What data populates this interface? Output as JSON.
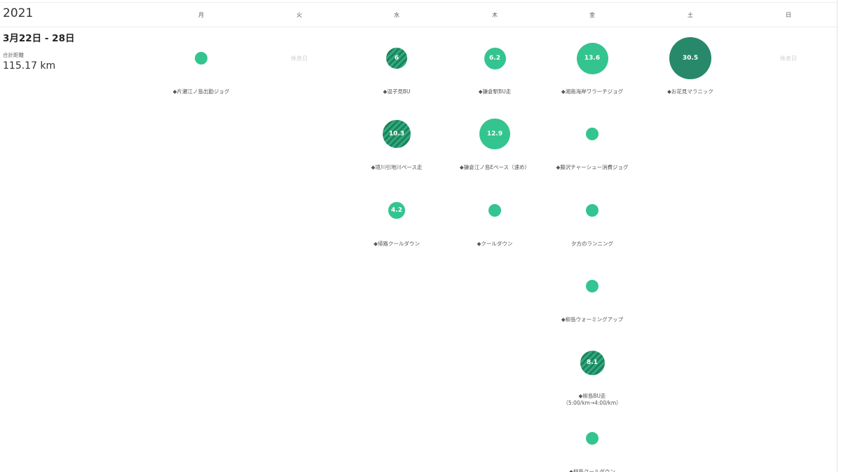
{
  "year": "2021",
  "days": [
    "月",
    "火",
    "水",
    "木",
    "金",
    "土",
    "日"
  ],
  "week": {
    "range": "3月22日 - 28日",
    "total_label": "合計距離",
    "total_value": "115.17 km"
  },
  "rest_label": "休息日",
  "colors": {
    "plain": "#34c490",
    "dark": "#27896a",
    "stripe_a": "#2faa7d",
    "stripe_b": "#1e7f5c"
  },
  "activities": [
    {
      "day": 0,
      "row": 0,
      "value": "",
      "label": "◆片瀬江ノ島出勤ジョグ",
      "style": "plain",
      "size": 18
    },
    {
      "day": 2,
      "row": 0,
      "value": "6",
      "label": "◆逗子見BU",
      "style": "striped",
      "size": 30
    },
    {
      "day": 2,
      "row": 1,
      "value": "10.3",
      "label": "◆境川引地川ペース走",
      "style": "striped",
      "size": 40
    },
    {
      "day": 2,
      "row": 2,
      "value": "4.2",
      "label": "◆帰路クールダウン",
      "style": "plain",
      "size": 24
    },
    {
      "day": 3,
      "row": 0,
      "value": "6.2",
      "label": "◆鎌倉駅BU走",
      "style": "plain",
      "size": 31
    },
    {
      "day": 3,
      "row": 1,
      "value": "12.9",
      "label": "◆鎌倉江ノ島Eペース（速め）",
      "style": "plain",
      "size": 44
    },
    {
      "day": 3,
      "row": 2,
      "value": "",
      "label": "◆クールダウン",
      "style": "plain",
      "size": 18
    },
    {
      "day": 4,
      "row": 0,
      "value": "13.6",
      "label": "◆湘南海岸ワラーチジョグ",
      "style": "plain",
      "size": 45
    },
    {
      "day": 4,
      "row": 1,
      "value": "",
      "label": "◆藤沢チャーシュー消費ジョグ",
      "style": "plain",
      "size": 18
    },
    {
      "day": 4,
      "row": 2,
      "value": "",
      "label": "夕方のランニング",
      "style": "plain",
      "size": 18
    },
    {
      "day": 4,
      "row": 3,
      "value": "",
      "label": "◆柳島ウォーミングアップ",
      "style": "plain",
      "size": 18
    },
    {
      "day": 4,
      "row": 4,
      "value": "8.1",
      "label": "◆柳島BU走\n（5:00/km→4:00/km）",
      "style": "striped",
      "size": 35
    },
    {
      "day": 4,
      "row": 5,
      "value": "",
      "label": "◆柳島クールダウン",
      "style": "plain",
      "size": 18
    },
    {
      "day": 5,
      "row": 0,
      "value": "30.5",
      "label": "◆お花見マラニック",
      "style": "dark",
      "size": 60
    }
  ],
  "rest_days": [
    1,
    6
  ]
}
